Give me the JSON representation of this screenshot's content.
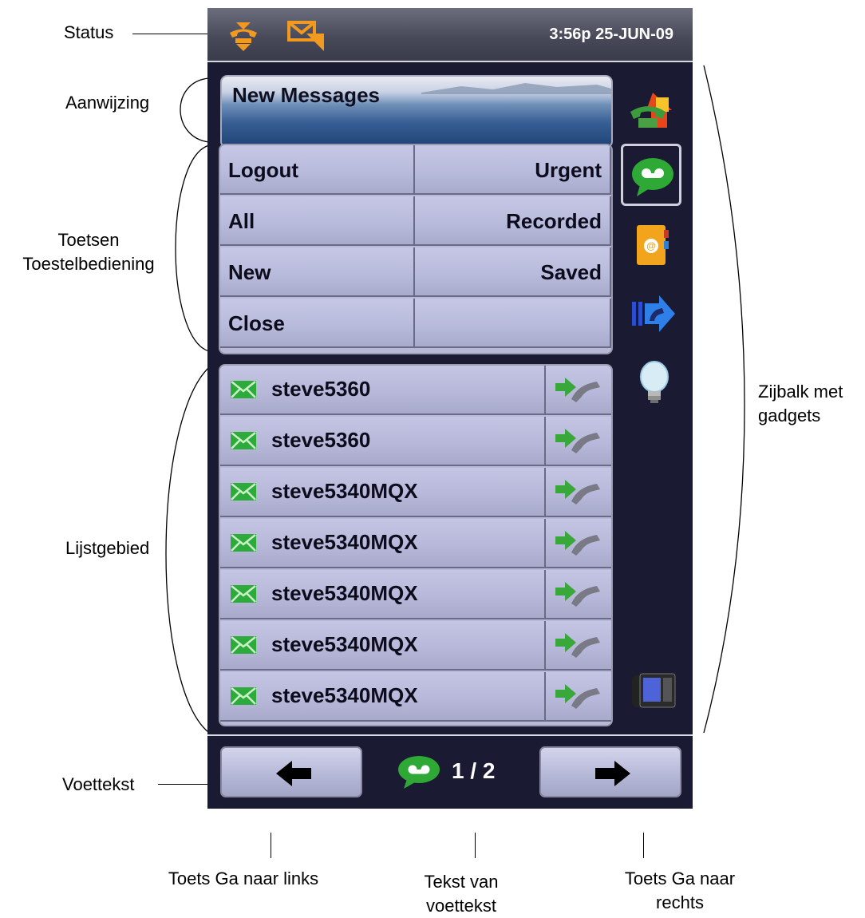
{
  "callouts": {
    "status": "Status",
    "prompt": "Aanwijzing",
    "keys_line1": "Toetsen",
    "keys_line2": "Toestelbediening",
    "list": "Lijstgebied",
    "footer": "Voettekst",
    "sidebar_line1": "Zijbalk met",
    "sidebar_line2": "gadgets",
    "left_key": "Toets Ga naar links",
    "footer_text_line1": "Tekst van",
    "footer_text_line2": "voettekst",
    "right_key_line1": "Toets Ga naar",
    "right_key_line2": "rechts"
  },
  "status_bar": {
    "datetime": "3:56p 25-JUN-09",
    "icons": [
      "phone-transfer-icon",
      "message-waiting-icon"
    ]
  },
  "prompt": {
    "title": "New Messages"
  },
  "softkeys": {
    "left": [
      "Logout",
      "All",
      "New",
      "Close"
    ],
    "right": [
      "Urgent",
      "Recorded",
      "Saved",
      ""
    ]
  },
  "messages": [
    {
      "name": "steve5360"
    },
    {
      "name": "steve5360"
    },
    {
      "name": "steve5340MQX"
    },
    {
      "name": "steve5340MQX"
    },
    {
      "name": "steve5340MQX"
    },
    {
      "name": "steve5340MQX"
    },
    {
      "name": "steve5340MQX"
    }
  ],
  "sidebar": {
    "gadgets": [
      "home-phone-icon",
      "voicemail-icon",
      "contacts-icon",
      "forward-call-icon",
      "help-bulb-icon",
      "desk-phone-icon"
    ],
    "selected": "voicemail-icon"
  },
  "footer": {
    "page": "1 / 2"
  },
  "colors": {
    "screen_bg": "#1a1a33",
    "status_icon": "#f29a1f",
    "message_icon": "#2eaa3a",
    "key_face": "#b9bbdc"
  }
}
